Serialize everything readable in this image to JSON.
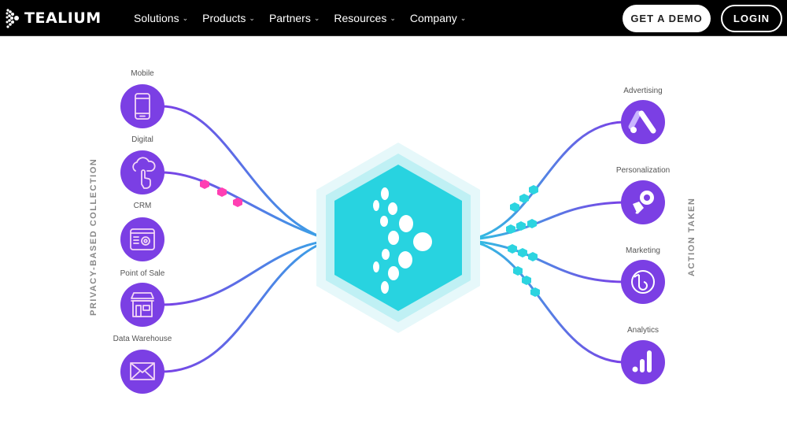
{
  "header": {
    "brand": "TEALIUM",
    "nav": [
      {
        "label": "Solutions",
        "icon": "chevron-down-icon"
      },
      {
        "label": "Products",
        "icon": "chevron-down-icon"
      },
      {
        "label": "Partners",
        "icon": "chevron-down-icon"
      },
      {
        "label": "Resources",
        "icon": "chevron-down-icon"
      },
      {
        "label": "Company",
        "icon": "chevron-down-icon"
      }
    ],
    "demo_button": "GET A DEMO",
    "login_button": "LOGIN",
    "chevron": "⌄"
  },
  "diagram": {
    "left_title": "PRIVACY-BASED COLLECTION",
    "right_title": "ACTION TAKEN",
    "sources": [
      {
        "label": "Mobile",
        "icon": "mobile-phone-icon"
      },
      {
        "label": "Digital",
        "icon": "cloud-touch-icon"
      },
      {
        "label": "CRM",
        "icon": "crm-settings-icon"
      },
      {
        "label": "Point of Sale",
        "icon": "storefront-icon"
      },
      {
        "label": "Data Warehouse",
        "icon": "envelope-icon"
      }
    ],
    "destinations": [
      {
        "label": "Advertising",
        "icon": "google-ads-icon"
      },
      {
        "label": "Personalization",
        "icon": "rocket-icon"
      },
      {
        "label": "Marketing",
        "icon": "braze-icon"
      },
      {
        "label": "Analytics",
        "icon": "analytics-bars-icon"
      }
    ],
    "hub": {
      "icon": "tealium-hub-icon"
    },
    "colors": {
      "node_purple": "#7b3fe4",
      "line_purple": "#7a4be8",
      "line_blue": "#3fa0e8",
      "hub_teal": "#28d3e0",
      "hub_glow": "#bff0f4",
      "packet_pink": "#ff3fb3",
      "packet_teal": "#2cd4e0"
    }
  }
}
